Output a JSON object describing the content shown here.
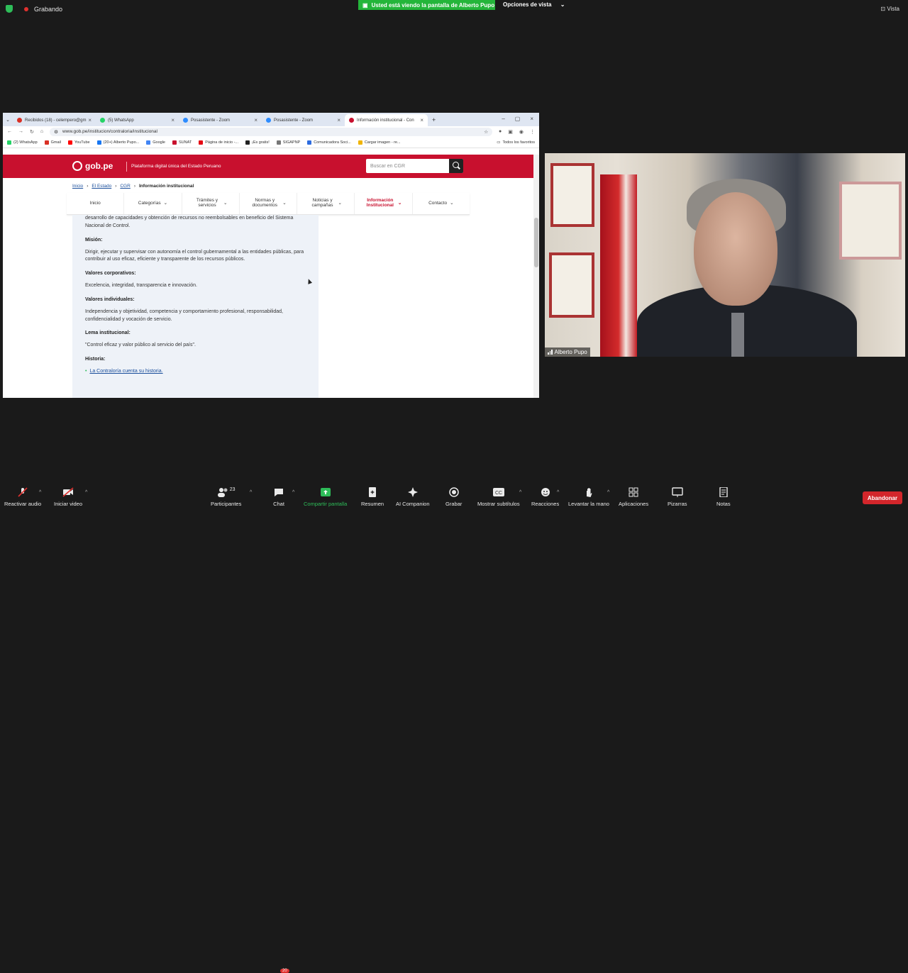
{
  "zoom_top": {
    "recording_label": "Grabando",
    "share_banner": "Usted está viendo la pantalla de Alberto Pupo",
    "view_options": "Opciones de vista",
    "view_label": "Vista"
  },
  "browser": {
    "tabs": [
      {
        "label": "Recibidos (18) - celempero@gm",
        "icon": "gmail-icon",
        "color": "#d93025"
      },
      {
        "label": "(5) WhatsApp",
        "icon": "whatsapp-icon",
        "color": "#25d366"
      },
      {
        "label": "Posasistente - Zoom",
        "icon": "zoom-icon",
        "color": "#2d8cff"
      },
      {
        "label": "Posasistente - Zoom",
        "icon": "zoom-icon",
        "color": "#2d8cff"
      },
      {
        "label": "Información institucional - Con",
        "icon": "peru-icon",
        "color": "#c8102e"
      }
    ],
    "url": "www.gob.pe/institucion/contraloria/institucional",
    "bookmarks": [
      {
        "label": "(2) WhatsApp",
        "color": "#25d366"
      },
      {
        "label": "Gmail",
        "color": "#d93025"
      },
      {
        "label": "YouTube",
        "color": "#ff0000"
      },
      {
        "label": "(20+) Alberto Pupo...",
        "color": "#1877f2"
      },
      {
        "label": "Google",
        "color": "#4285f4"
      },
      {
        "label": "SUNAT",
        "color": "#c8102e"
      },
      {
        "label": "Página de inicio -...",
        "color": "#e50914"
      },
      {
        "label": "¡Es gratis!",
        "color": "#222222"
      },
      {
        "label": "SIGAPNP",
        "color": "#777777"
      },
      {
        "label": "Comunicadora Soci...",
        "color": "#2d6cdf"
      },
      {
        "label": "Cargar imagen - re...",
        "color": "#f0b400"
      }
    ],
    "bookmarks_right": "Todos los favoritos"
  },
  "gob": {
    "logo": "gob.pe",
    "tagline": "Plataforma digital única del Estado Peruano",
    "search_placeholder": "Buscar en CGR",
    "breadcrumb": [
      "Inicio",
      "El Estado",
      "CGR",
      "Información institucional"
    ],
    "nav": [
      "Inicio",
      "Categorías",
      "Trámites y servicios",
      "Normas y documentos",
      "Noticias y campañas",
      "Información Institucional",
      "Contacto"
    ],
    "content": {
      "intro": "desarrollo de capacidades y obtención de recursos no reembolsables en beneficio del Sistema Nacional de Control.",
      "mision_title": "Misión:",
      "mision": "Dirigir, ejecutar y supervisar con autonomía el control gubernamental a las entidades públicas, para contribuir al uso eficaz, eficiente y transparente de los recursos públicos.",
      "valores_corp_title": "Valores corporativos:",
      "valores_corp": "Excelencia, integridad, transparencia e innovación.",
      "valores_ind_title": "Valores individuales:",
      "valores_ind": "Independencia y objetividad, competencia y comportamiento profesional, responsabilidad, confidencialidad y vocación de servicio.",
      "lema_title": "Lema institucional:",
      "lema": "\"Control eficaz y valor público al servicio del país\".",
      "historia_title": "Historia:",
      "historia_link": "La Contraloría cuenta su historia."
    }
  },
  "participant": {
    "name": "Alberto Pupo"
  },
  "toolbar": {
    "items": [
      {
        "label": "Reactivar audio",
        "icon": "mic-muted-icon"
      },
      {
        "label": "Iniciar video",
        "icon": "video-off-icon"
      },
      {
        "label": "Participantes",
        "icon": "participants-icon",
        "count": "23"
      },
      {
        "label": "Chat",
        "icon": "chat-icon",
        "badge": "20"
      },
      {
        "label": "Compartir pantalla",
        "icon": "share-screen-icon"
      },
      {
        "label": "Resumen",
        "icon": "summary-icon"
      },
      {
        "label": "AI Companion",
        "icon": "ai-companion-icon"
      },
      {
        "label": "Grabar",
        "icon": "record-icon"
      },
      {
        "label": "Mostrar subtítulos",
        "icon": "cc-icon"
      },
      {
        "label": "Reacciones",
        "icon": "reactions-icon"
      },
      {
        "label": "Levantar la mano",
        "icon": "raise-hand-icon"
      },
      {
        "label": "Aplicaciones",
        "icon": "apps-icon"
      },
      {
        "label": "Pizarras",
        "icon": "whiteboard-icon"
      },
      {
        "label": "Notas",
        "icon": "notes-icon"
      }
    ],
    "leave": "Abandonar"
  }
}
